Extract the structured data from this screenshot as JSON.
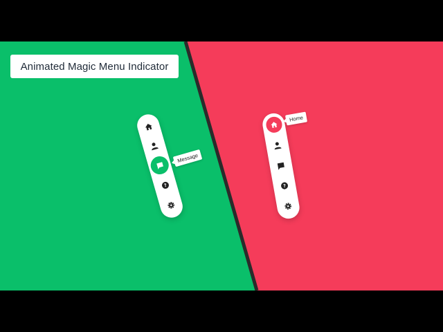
{
  "title": "Animated Magic Menu Indicator",
  "colors": {
    "green": "#0abf6a",
    "red": "#f53c5a",
    "divider": "#2b2b2b",
    "icon": "#222222"
  },
  "menu_green": {
    "items": [
      {
        "icon": "home-icon",
        "active": false
      },
      {
        "icon": "user-icon",
        "active": false
      },
      {
        "icon": "message-icon",
        "active": true
      },
      {
        "icon": "help-icon",
        "active": false
      },
      {
        "icon": "settings-icon",
        "active": false
      }
    ],
    "tooltip": "Message"
  },
  "menu_red": {
    "items": [
      {
        "icon": "home-icon",
        "active": true
      },
      {
        "icon": "user-icon",
        "active": false
      },
      {
        "icon": "message-icon",
        "active": false
      },
      {
        "icon": "help-icon",
        "active": false
      },
      {
        "icon": "settings-icon",
        "active": false
      }
    ],
    "tooltip": "Home"
  }
}
